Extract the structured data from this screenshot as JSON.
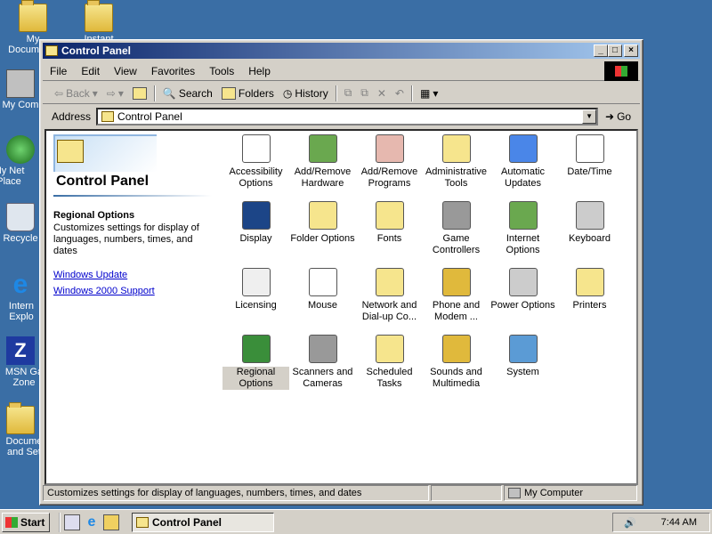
{
  "desktop": {
    "icons": [
      {
        "label": "My Documents",
        "icon": "my-documents-icon"
      },
      {
        "label": "Instant",
        "icon": "folder-icon"
      },
      {
        "label": "My Com",
        "icon": "my-computer-icon"
      },
      {
        "label": "My Net Place",
        "icon": "network-places-icon"
      },
      {
        "label": "Recycle",
        "icon": "recycle-bin-icon"
      },
      {
        "label": "Intern Explo",
        "icon": "internet-explorer-icon"
      },
      {
        "label": "MSN Ga Zone",
        "icon": "msn-gaming-zone-icon"
      },
      {
        "label": "Docume and Set",
        "icon": "folder-icon"
      }
    ]
  },
  "window": {
    "title": "Control Panel",
    "buttons": {
      "minimize": "_",
      "maximize": "□",
      "close": "×"
    }
  },
  "menubar": [
    "File",
    "Edit",
    "View",
    "Favorites",
    "Tools",
    "Help"
  ],
  "toolbar": {
    "back": "Back",
    "forward_icon": "forward-arrow-icon",
    "search": "Search",
    "folders": "Folders",
    "history": "History"
  },
  "address": {
    "label": "Address",
    "value": "Control Panel",
    "go": "Go"
  },
  "left_pane": {
    "title": "Control Panel",
    "selected_title": "Regional Options",
    "selected_desc": "Customizes settings for display of languages, numbers, times, and dates",
    "links": [
      "Windows Update",
      "Windows 2000 Support"
    ]
  },
  "items": [
    {
      "label": "Accessibility Options",
      "icon": "accessibility-icon",
      "color": "#ffffff"
    },
    {
      "label": "Add/Remove Hardware",
      "icon": "add-hardware-icon",
      "color": "#6aa84f"
    },
    {
      "label": "Add/Remove Programs",
      "icon": "add-programs-icon",
      "color": "#e6b8af"
    },
    {
      "label": "Administrative Tools",
      "icon": "admin-tools-icon",
      "color": "#f6e58d"
    },
    {
      "label": "Automatic Updates",
      "icon": "windows-update-icon",
      "color": "#4a86e8"
    },
    {
      "label": "Date/Time",
      "icon": "date-time-icon",
      "color": "#ffffff"
    },
    {
      "label": "Display",
      "icon": "display-icon",
      "color": "#1c4587"
    },
    {
      "label": "Folder Options",
      "icon": "folder-options-icon",
      "color": "#f6e58d"
    },
    {
      "label": "Fonts",
      "icon": "fonts-icon",
      "color": "#f6e58d"
    },
    {
      "label": "Game Controllers",
      "icon": "joystick-icon",
      "color": "#999999"
    },
    {
      "label": "Internet Options",
      "icon": "internet-options-icon",
      "color": "#6aa84f"
    },
    {
      "label": "Keyboard",
      "icon": "keyboard-icon",
      "color": "#cccccc"
    },
    {
      "label": "Licensing",
      "icon": "licensing-icon",
      "color": "#efefef"
    },
    {
      "label": "Mouse",
      "icon": "mouse-icon",
      "color": "#ffffff"
    },
    {
      "label": "Network and Dial-up Co...",
      "icon": "network-icon",
      "color": "#f6e58d"
    },
    {
      "label": "Phone and Modem ...",
      "icon": "phone-icon",
      "color": "#e0b93c"
    },
    {
      "label": "Power Options",
      "icon": "power-icon",
      "color": "#cccccc"
    },
    {
      "label": "Printers",
      "icon": "printers-icon",
      "color": "#f6e58d"
    },
    {
      "label": "Regional Options",
      "icon": "globe-icon",
      "color": "#3a8e3a"
    },
    {
      "label": "Scanners and Cameras",
      "icon": "scanner-icon",
      "color": "#999999"
    },
    {
      "label": "Scheduled Tasks",
      "icon": "scheduled-tasks-icon",
      "color": "#f6e58d"
    },
    {
      "label": "Sounds and Multimedia",
      "icon": "speaker-icon",
      "color": "#e0b93c"
    },
    {
      "label": "System",
      "icon": "system-icon",
      "color": "#5b9bd5"
    }
  ],
  "status": {
    "text": "Customizes settings for display of languages, numbers, times, and dates",
    "zone": "My Computer"
  },
  "taskbar": {
    "start": "Start",
    "task": "Control Panel",
    "clock": "7:44 AM"
  }
}
